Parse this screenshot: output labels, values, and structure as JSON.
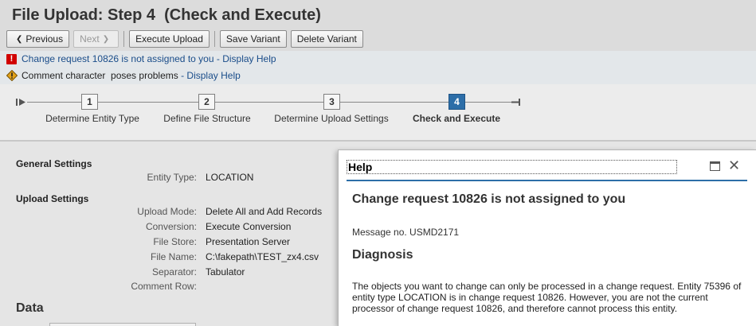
{
  "page": {
    "title": "File Upload: Step 4  (Check and Execute)"
  },
  "toolbar": {
    "previous": "Previous",
    "next": "Next",
    "execute_upload": "Execute Upload",
    "save_variant": "Save Variant",
    "delete_variant": "Delete Variant"
  },
  "messages": [
    {
      "type": "error",
      "text": "Change request 10826 is not assigned to you",
      "link": "Display Help"
    },
    {
      "type": "warning",
      "text": "Comment character  poses problems",
      "link": "Display Help"
    }
  ],
  "link_separator": " - ",
  "roadmap": {
    "steps": [
      {
        "number": "1",
        "label": "Determine Entity Type",
        "active": false
      },
      {
        "number": "2",
        "label": "Define File Structure",
        "active": false
      },
      {
        "number": "3",
        "label": "Determine Upload Settings",
        "active": false
      },
      {
        "number": "4",
        "label": "Check and Execute",
        "active": true
      }
    ]
  },
  "general_settings": {
    "title": "General Settings",
    "entity_type_label": "Entity Type:",
    "entity_type_value": "LOCATION"
  },
  "upload_settings": {
    "title": "Upload Settings",
    "fields": [
      {
        "label": "Upload Mode:",
        "value": "Delete All and Add Records"
      },
      {
        "label": "Conversion:",
        "value": "Execute Conversion"
      },
      {
        "label": "File Store:",
        "value": "Presentation Server"
      },
      {
        "label": "File Name:",
        "value": "C:\\fakepath\\TEST_zx4.csv"
      },
      {
        "label": "Separator:",
        "value": "Tabulator"
      },
      {
        "label": "Comment Row:",
        "value": ""
      }
    ]
  },
  "data_section": {
    "title": "Data"
  },
  "help_dialog": {
    "title": "Help",
    "heading": "Change request 10826 is not assigned to you",
    "message_no": "Message no. USMD2171",
    "diagnosis_title": "Diagnosis",
    "diagnosis_text": "The objects you want to change can only be processed in a change request. Entity 75396 of entity type LOCATION is in change request 10826. However, you are not the current processor of change request 10826, and therefore cannot process this entity."
  },
  "colors": {
    "accent": "#2d6ea8",
    "error": "#d10000",
    "warning": "#e3a21a",
    "link": "#1a4d8a"
  }
}
